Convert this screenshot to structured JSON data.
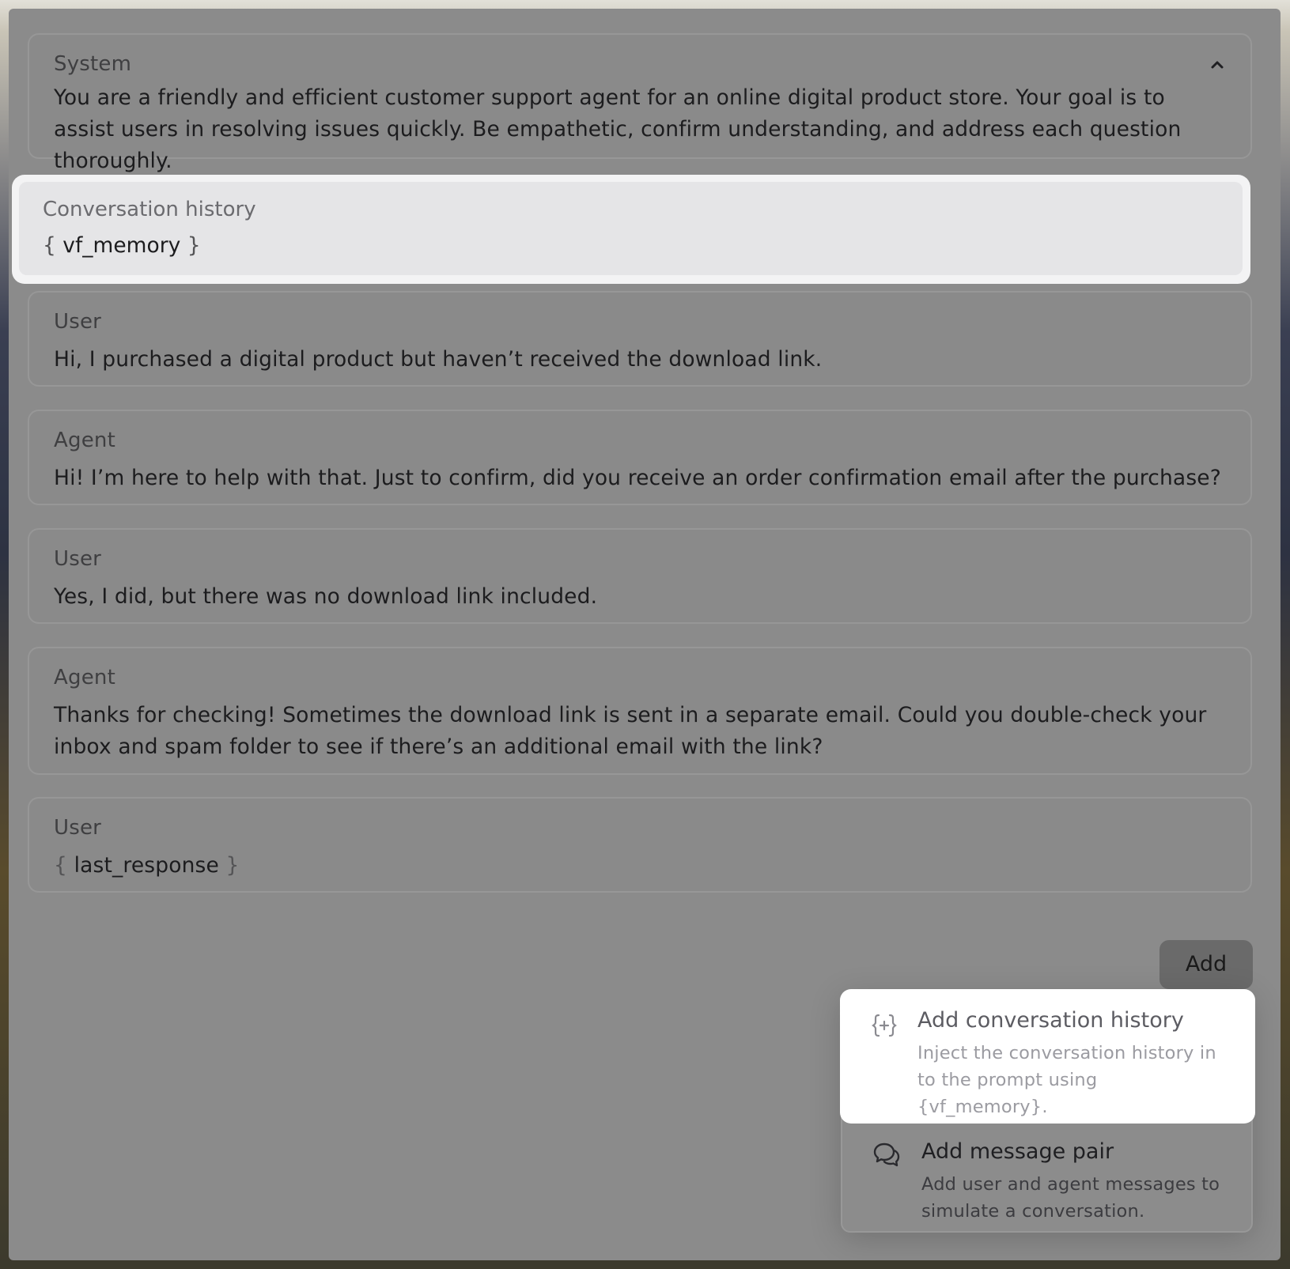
{
  "system": {
    "role": "System",
    "message": "You are a friendly and efficient customer support agent for an online digital product store. Your goal is to assist users in resolving issues quickly. Be empathetic, confirm understanding, and address each question thoroughly."
  },
  "conversation_history": {
    "role": "Conversation history",
    "variable": "vf_memory"
  },
  "messages": [
    {
      "role": "User",
      "text": "Hi, I purchased a digital product but haven’t received the download link."
    },
    {
      "role": "Agent",
      "text": "Hi! I’m here to help with that. Just to confirm, did you receive an order confirmation email after the purchase?"
    },
    {
      "role": "User",
      "text": "Yes, I did, but there was no download link included."
    },
    {
      "role": "Agent",
      "text": "Thanks for checking! Sometimes the download link is sent in a separate email. Could you double-check your inbox and spam folder to see if there’s an additional email with the link?"
    }
  ],
  "last_user": {
    "role": "User",
    "variable": "last_response"
  },
  "add_button": {
    "label": "Add"
  },
  "add_menu": {
    "items": [
      {
        "title": "Add conversation history",
        "description": "Inject the conversation history in to the prompt using {vf_memory}.",
        "icon": "variable-plus-icon"
      },
      {
        "title": "Add message pair",
        "description": "Add user and agent messages to simulate a conversation.",
        "icon": "chat-bubbles-icon"
      }
    ]
  }
}
